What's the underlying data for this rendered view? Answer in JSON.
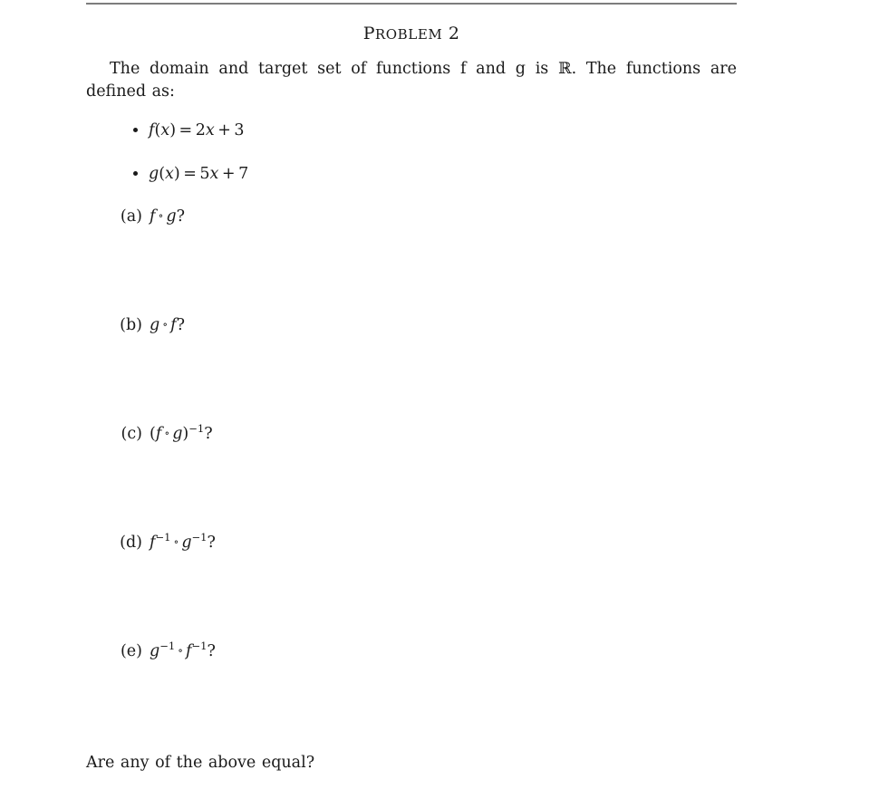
{
  "document": {
    "title_first_letter": "P",
    "title_small_caps": "ROBLEM",
    "title_number": "2",
    "intro_part1": "The domain and target set of functions f and g is ",
    "intro_symbol_R": "ℝ",
    "intro_part2": ". The functions are defined as:",
    "closing_question": "Are any of the above equal?"
  },
  "definitions": [
    {
      "bullet": "•",
      "fn": "f",
      "open": "(",
      "var": "x",
      "close": ")",
      "equals": "=",
      "coefficient": "2",
      "term_var": "x",
      "plus": "+",
      "constant": "3",
      "full": "f(x) = 2x + 3"
    },
    {
      "bullet": "•",
      "fn": "g",
      "open": "(",
      "var": "x",
      "close": ")",
      "equals": "=",
      "coefficient": "5",
      "term_var": "x",
      "plus": "+",
      "constant": "7",
      "full": "g(x) = 5x + 7"
    }
  ],
  "questions": [
    {
      "label": "(a)",
      "expression": "f ∘ g?",
      "left": "f",
      "ring": "∘",
      "right": "g",
      "question_mark": "?",
      "left_sup": "",
      "right_sup": "",
      "has_parens": false,
      "group_sup": ""
    },
    {
      "label": "(b)",
      "expression": "g ∘ f?",
      "left": "g",
      "ring": "∘",
      "right": "f",
      "question_mark": "?",
      "left_sup": "",
      "right_sup": "",
      "has_parens": false,
      "group_sup": ""
    },
    {
      "label": "(c)",
      "expression": "(f ∘ g)⁻¹?",
      "left": "f",
      "ring": "∘",
      "right": "g",
      "question_mark": "?",
      "left_sup": "",
      "right_sup": "",
      "has_parens": true,
      "open_paren": "(",
      "close_paren": ")",
      "group_sup": "−1"
    },
    {
      "label": "(d)",
      "expression": "f⁻¹ ∘ g⁻¹?",
      "left": "f",
      "ring": "∘",
      "right": "g",
      "question_mark": "?",
      "left_sup": "−1",
      "right_sup": "−1",
      "has_parens": false,
      "group_sup": ""
    },
    {
      "label": "(e)",
      "expression": "g⁻¹ ∘ f⁻¹?",
      "left": "g",
      "ring": "∘",
      "right": "f",
      "question_mark": "?",
      "left_sup": "−1",
      "right_sup": "−1",
      "has_parens": false,
      "group_sup": ""
    }
  ],
  "colors": {
    "text": "#1a1a1a",
    "rule": "#7d7d7d",
    "background": "#ffffff"
  }
}
